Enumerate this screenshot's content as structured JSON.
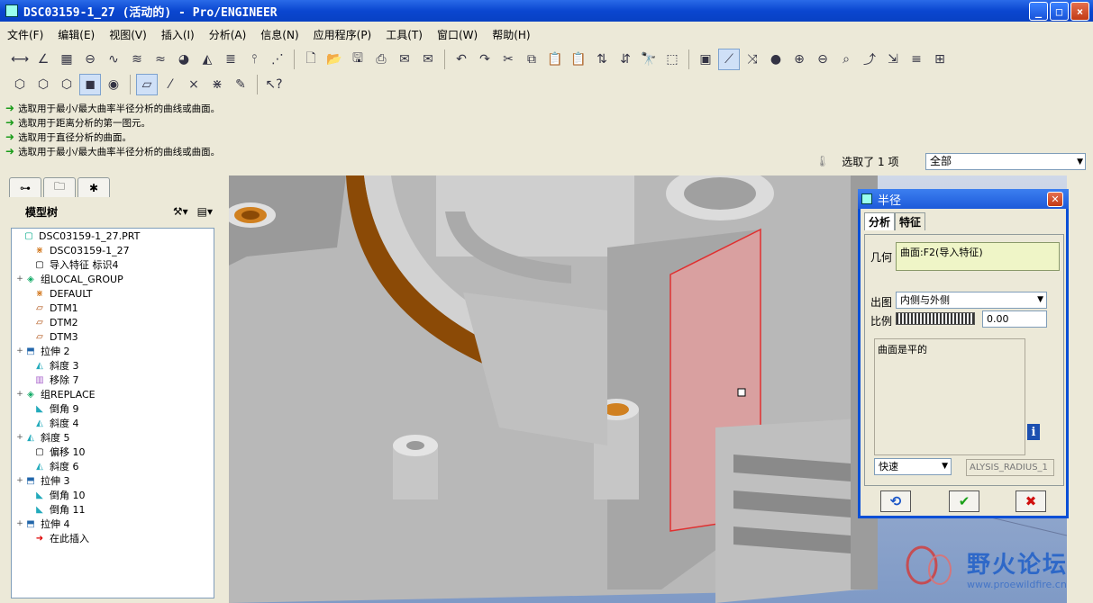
{
  "window": {
    "title": "DSC03159-1_27 (活动的) - Pro/ENGINEER",
    "buttons": [
      "_",
      "□",
      "×"
    ]
  },
  "menu": [
    "文件(F)",
    "编辑(E)",
    "视图(V)",
    "插入(I)",
    "分析(A)",
    "信息(N)",
    "应用程序(P)",
    "工具(T)",
    "窗口(W)",
    "帮助(H)"
  ],
  "messages": [
    "选取用于最小/最大曲率半径分析的曲线或曲面。",
    "选取用于距离分析的第一图元。",
    "选取用于直径分析的曲面。",
    "选取用于最小/最大曲率半径分析的曲线或曲面。"
  ],
  "selection": {
    "status": "选取了 1 项",
    "filter": "全部"
  },
  "tree": {
    "header": "模型树",
    "nodes": [
      {
        "label": "DSC03159-1_27.PRT",
        "expand": "",
        "icon": "part-icon"
      },
      {
        "label": "DSC03159-1_27",
        "expand": "",
        "icon": "csys-icon"
      },
      {
        "label": "导入特征 标识4",
        "expand": "",
        "icon": "import-feature-icon"
      },
      {
        "label": "组LOCAL_GROUP",
        "expand": "+",
        "icon": "group-icon"
      },
      {
        "label": "DEFAULT",
        "expand": "",
        "icon": "csys-icon"
      },
      {
        "label": "DTM1",
        "expand": "",
        "icon": "datum-plane-icon"
      },
      {
        "label": "DTM2",
        "expand": "",
        "icon": "datum-plane-icon"
      },
      {
        "label": "DTM3",
        "expand": "",
        "icon": "datum-plane-icon"
      },
      {
        "label": "拉伸 2",
        "expand": "+",
        "icon": "extrude-icon"
      },
      {
        "label": "斜度 3",
        "expand": "",
        "icon": "draft-icon"
      },
      {
        "label": "移除 7",
        "expand": "",
        "icon": "remove-icon"
      },
      {
        "label": "组REPLACE",
        "expand": "+",
        "icon": "group-icon"
      },
      {
        "label": "倒角 9",
        "expand": "",
        "icon": "round-icon"
      },
      {
        "label": "斜度 4",
        "expand": "",
        "icon": "draft-icon"
      },
      {
        "label": "斜度 5",
        "expand": "+",
        "icon": "draft-icon"
      },
      {
        "label": "偏移 10",
        "expand": "",
        "icon": "offset-icon"
      },
      {
        "label": "斜度 6",
        "expand": "",
        "icon": "draft-icon"
      },
      {
        "label": "拉伸 3",
        "expand": "+",
        "icon": "extrude-icon"
      },
      {
        "label": "倒角 10",
        "expand": "",
        "icon": "round-icon"
      },
      {
        "label": "倒角 11",
        "expand": "",
        "icon": "round-icon"
      },
      {
        "label": "拉伸 4",
        "expand": "+",
        "icon": "extrude-icon"
      },
      {
        "label": "在此插入",
        "expand": "",
        "icon": "insert-here-icon"
      }
    ]
  },
  "dialog": {
    "title": "半径",
    "tabs": [
      "分析",
      "特征"
    ],
    "geometry_label": "几何",
    "geometry_value": "曲面:F2(导入特征)",
    "plot_label": "出图",
    "plot_value": "内侧与外侧",
    "ratio_label": "比例",
    "ratio_value": "0.00",
    "result": "曲面是平的",
    "mode": "快速",
    "feature_name": "ALYSIS_RADIUS_1"
  },
  "watermark": {
    "title": "野火论坛",
    "url": "www.proewildfire.cn"
  },
  "colors": {
    "titlebar": "#0a46d0",
    "model": "#b8b8b8",
    "highlight": "#8b4a06",
    "selected_surface": "#d9a0a0",
    "background_top": "#cfd8e8",
    "background_bottom": "#7f9ac6"
  }
}
